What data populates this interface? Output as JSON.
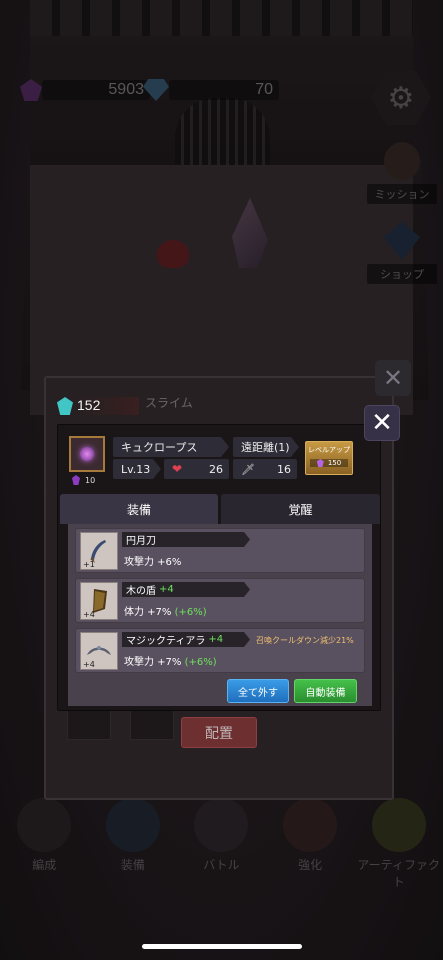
{
  "hud": {
    "gems_purple": "5903",
    "gems_blue": "70",
    "settings_icon": "gear-icon",
    "mission_label": "ミッション",
    "shop_label": "ショップ"
  },
  "bottom_nav": [
    {
      "label": "編成",
      "icon": "formation-icon"
    },
    {
      "label": "装備",
      "icon": "equipment-icon"
    },
    {
      "label": "バトル",
      "icon": "battle-icon"
    },
    {
      "label": "強化",
      "icon": "upgrade-icon"
    },
    {
      "label": "アーティファクト",
      "icon": "artifact-icon"
    }
  ],
  "background_dialog": {
    "unit_name": "スライム",
    "deploy_label": "配置"
  },
  "popup": {
    "gem_count": "152",
    "character": {
      "name": "キュクロープス",
      "range": "遠距離(1)",
      "level": "Lv.13",
      "hp": "26",
      "attack": "16",
      "cost": "10"
    },
    "level_up": {
      "label": "レベルアップ",
      "cost": "150"
    },
    "tabs": [
      {
        "label": "装備",
        "active": true
      },
      {
        "label": "覚醒",
        "active": false
      }
    ],
    "equipment": [
      {
        "name": "円月刀",
        "plus": "",
        "icon_plus": "+1",
        "stat": "攻撃力 +6%",
        "bonus": "",
        "extra": ""
      },
      {
        "name": "木の盾",
        "plus": "+4",
        "icon_plus": "+4",
        "stat": "体力 +7%",
        "bonus": "(+6%)",
        "extra": ""
      },
      {
        "name": "マジックティアラ",
        "plus": "+4",
        "icon_plus": "+4",
        "stat": "攻撃力 +7%",
        "bonus": "(+6%)",
        "extra": "召喚クールダウン減少21%"
      }
    ],
    "buttons": {
      "unequip_all": "全て外す",
      "auto_equip": "自動装備"
    }
  }
}
